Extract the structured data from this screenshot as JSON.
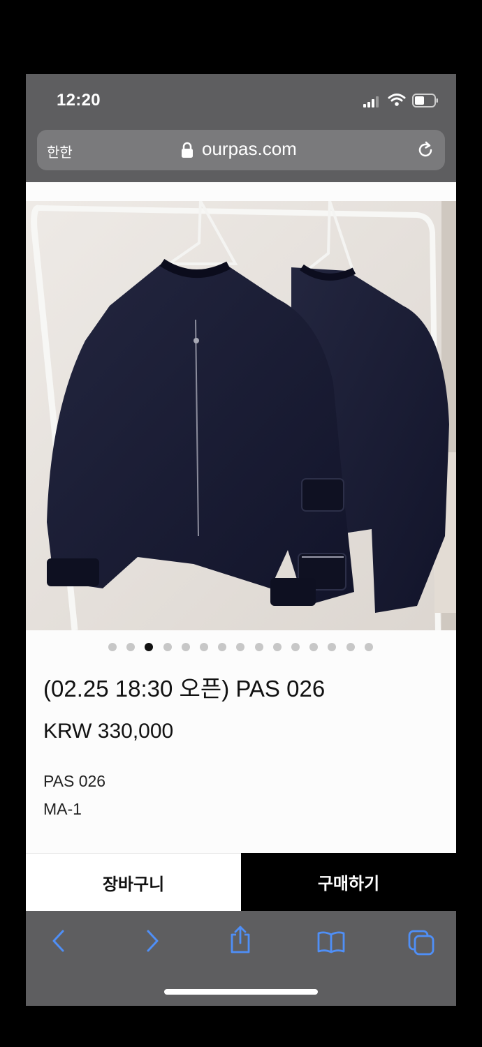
{
  "status_bar": {
    "time": "12:20"
  },
  "browser": {
    "aa_label": "한한",
    "url": "ourpas.com"
  },
  "carousel": {
    "total": 15,
    "active_index": 2
  },
  "product": {
    "title": "(02.25 18:30 오픈) PAS 026",
    "price": "KRW 330,000",
    "description_lines": [
      "PAS 026",
      "MA-1"
    ]
  },
  "actions": {
    "cart_label": "장바구니",
    "buy_label": "구매하기"
  },
  "toolbar": {
    "icons": [
      "back-icon",
      "forward-icon",
      "share-icon",
      "bookmarks-icon",
      "tabs-icon"
    ]
  },
  "colors": {
    "browser_chrome": "#5e5e60",
    "accent_blue": "#4f8ff7",
    "buy_button_bg": "#000000"
  }
}
